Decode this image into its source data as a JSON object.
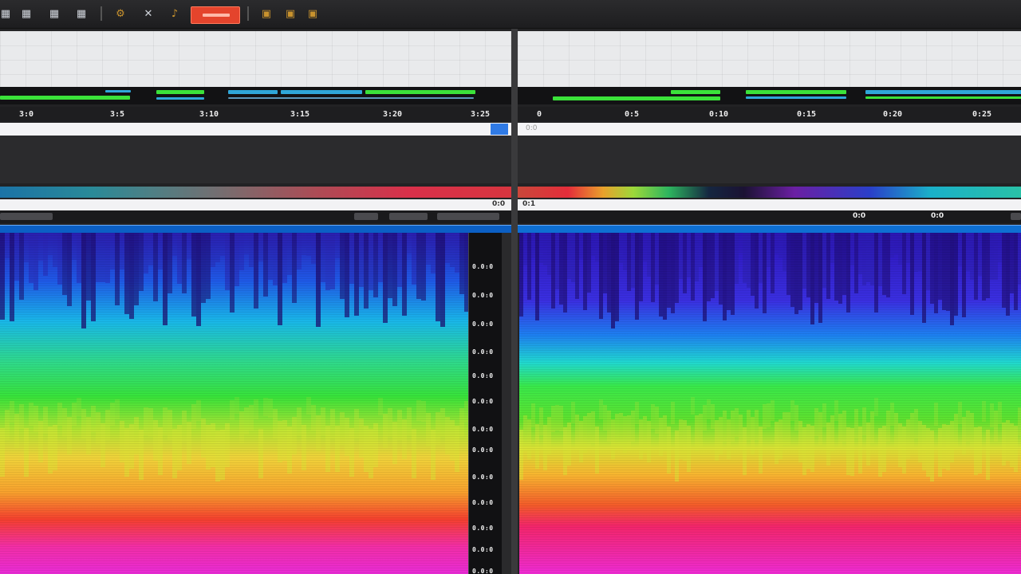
{
  "colors": {
    "record": "#e4442c",
    "meter_green": "#3be23a",
    "meter_cyan": "#2fa7d9",
    "selection": "#0b5fc4"
  },
  "toolbar": {
    "icons": [
      "grid-icon",
      "grid-icon",
      "grid-icon",
      "settings-icon",
      "cross-icon",
      "microphone-icon",
      "record-button",
      "folder-icon",
      "folder-icon",
      "folder-icon"
    ]
  },
  "left": {
    "ruler_ticks": [
      "3:0",
      "3:5",
      "3:10",
      "3:15",
      "3:20",
      "3:25"
    ],
    "info_value": "0:0",
    "freq_labels": [
      "0.0:0",
      "0.0:0",
      "0.0:0",
      "0.0:0",
      "0.0:0",
      "0.0:0",
      "0.0:0",
      "0.0:0",
      "0.0:0",
      "0.0:0",
      "0.0:0",
      "0.0:0",
      "0.0:0",
      "0.0:0"
    ]
  },
  "right": {
    "ruler_ticks": [
      "0",
      "0:5",
      "0:10",
      "0:15",
      "0:20",
      "0:25"
    ],
    "track_label": "0:0",
    "info_value": "0:1",
    "ctrl_values": [
      "0:0",
      "0:0"
    ]
  }
}
